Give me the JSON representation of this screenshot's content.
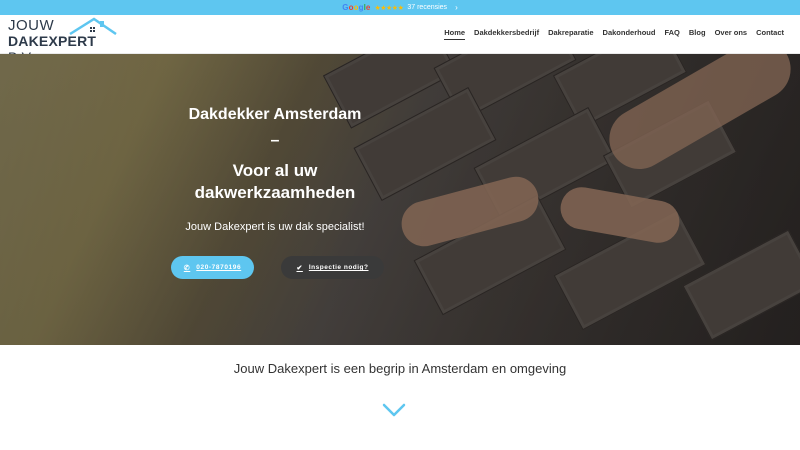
{
  "topbar": {
    "google_label": [
      "G",
      "o",
      "o",
      "g",
      "l",
      "e"
    ],
    "stars": "★★★★★",
    "reviews": "37 recensies",
    "chevron_icon": "chevron-right-icon"
  },
  "logo": {
    "line1": "JOUW",
    "line2": "DAKEXPERT",
    "suffix": "B.V."
  },
  "nav": {
    "items": [
      {
        "label": "Home"
      },
      {
        "label": "Dakdekkersbedrijf"
      },
      {
        "label": "Dakreparatie"
      },
      {
        "label": "Dakonderhoud"
      },
      {
        "label": "FAQ"
      },
      {
        "label": "Blog"
      },
      {
        "label": "Over ons"
      },
      {
        "label": "Contact"
      }
    ]
  },
  "hero": {
    "title_line1": "Dakdekker Amsterdam",
    "title_dash": "–",
    "title_line2": "Voor al uw dakwerkzaamheden",
    "subtitle": "Jouw Dakexpert is uw dak specialist!",
    "phone_button": "020-7870196",
    "inspect_button": "Inspectie nodig?"
  },
  "tagline": "Jouw Dakexpert is een begrip in Amsterdam en omgeving",
  "colors": {
    "accent": "#5ec6f0",
    "dark_button": "#3a3a3a",
    "logo_text": "#2d3a4a"
  }
}
